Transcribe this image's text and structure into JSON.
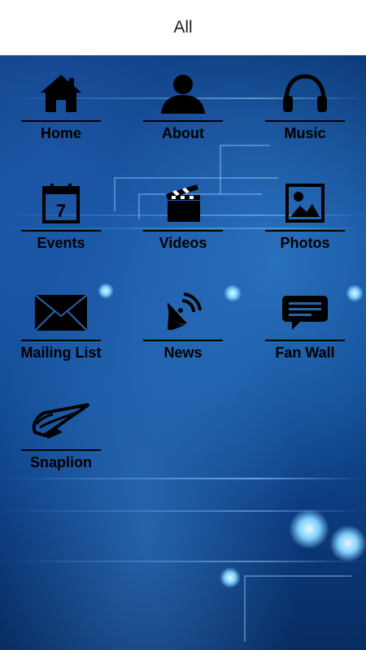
{
  "header": {
    "title": "All"
  },
  "menu": {
    "items": [
      {
        "label": "Home",
        "icon": "home-icon"
      },
      {
        "label": "About",
        "icon": "person-icon"
      },
      {
        "label": "Music",
        "icon": "headphones-icon"
      },
      {
        "label": "Events",
        "icon": "calendar-icon"
      },
      {
        "label": "Videos",
        "icon": "clapperboard-icon"
      },
      {
        "label": "Photos",
        "icon": "photo-icon"
      },
      {
        "label": "Mailing List",
        "icon": "envelope-icon"
      },
      {
        "label": "News",
        "icon": "satellite-dish-icon"
      },
      {
        "label": "Fan Wall",
        "icon": "chat-bubble-icon"
      },
      {
        "label": "Snaplion",
        "icon": "snaplion-logo-icon"
      }
    ],
    "calendar_day": "7"
  },
  "colors": {
    "background": "#0f4a92",
    "header": "#ffffff",
    "icon": "#000000"
  }
}
